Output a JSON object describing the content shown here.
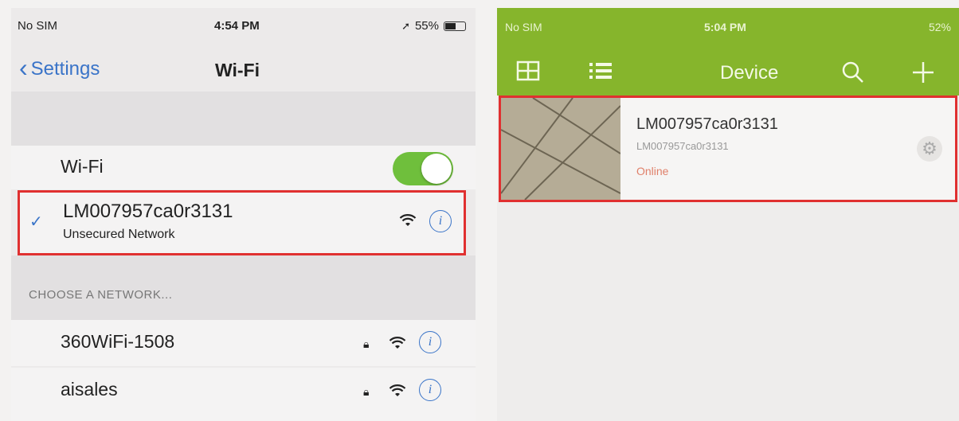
{
  "ios_settings": {
    "status": {
      "carrier": "No SIM",
      "time": "4:54 PM",
      "battery": "55%",
      "battery_level": 0.55
    },
    "back_label": "Settings",
    "title": "Wi-Fi",
    "wifi_label": "Wi-Fi",
    "wifi_enabled": true,
    "connected": {
      "name": "LM007957ca0r3131",
      "subtitle": "Unsecured Network"
    },
    "choose_header": "CHOOSE A NETWORK...",
    "networks": [
      {
        "name": "360WiFi-1508",
        "locked": true
      },
      {
        "name": "aisales",
        "locked": true
      }
    ],
    "icons": {
      "back": "chevron-left-icon",
      "check": "checkmark-icon",
      "wifi": "wifi-icon",
      "info": "info-icon",
      "lock": "lock-icon"
    }
  },
  "camera_app": {
    "status": {
      "carrier": "No SIM",
      "time": "5:04 PM",
      "battery": "52%"
    },
    "title": "Device",
    "device": {
      "name": "LM007957ca0r3131",
      "id": "LM007957ca0r3131",
      "status": "Online"
    },
    "accent_color": "#86b52c",
    "icons": [
      "grid-view-icon",
      "list-view-icon",
      "search-icon",
      "add-icon",
      "settings-gear-icon"
    ]
  },
  "highlight_color": "#e03030"
}
